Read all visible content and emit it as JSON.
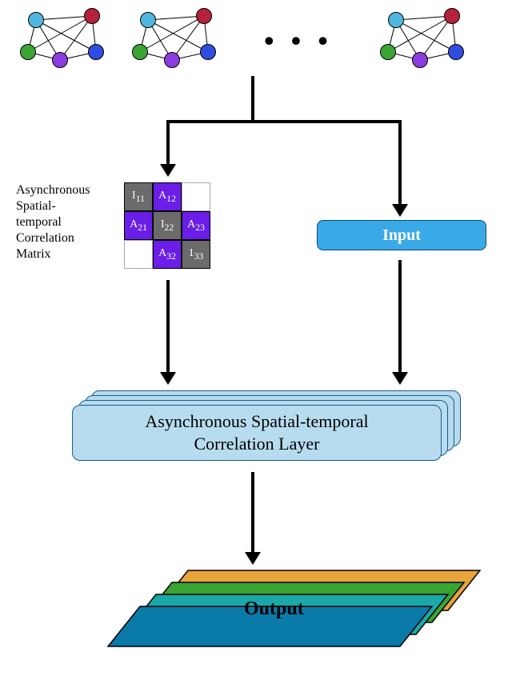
{
  "graphs": {
    "node_colors": [
      "#4fb6e0",
      "#b5223b",
      "#3aa532",
      "#8b3ce0",
      "#2f4de0"
    ]
  },
  "ellipsis": "• • •",
  "matrix": {
    "label_lines": [
      "Asynchronous",
      "Spatial-",
      "temporal",
      "Correlation",
      "Matrix"
    ],
    "cells": [
      {
        "kind": "gray",
        "text": "I",
        "sub": "11"
      },
      {
        "kind": "purple",
        "text": "A",
        "sub": "12"
      },
      {
        "kind": "white",
        "text": "",
        "sub": ""
      },
      {
        "kind": "purple",
        "text": "A",
        "sub": "21"
      },
      {
        "kind": "gray",
        "text": "I",
        "sub": "22"
      },
      {
        "kind": "purple",
        "text": "A",
        "sub": "23"
      },
      {
        "kind": "white",
        "text": "",
        "sub": ""
      },
      {
        "kind": "purple",
        "text": "A",
        "sub": "32"
      },
      {
        "kind": "gray",
        "text": "1",
        "sub": "33"
      }
    ]
  },
  "input_box": "Input",
  "layer_label": "Asynchronous Spatial-temporal\nCorrelation Layer",
  "output_label": "Output",
  "output_colors": [
    "#e8a33a",
    "#3aa532",
    "#1aa8a8",
    "#0a7aa8"
  ],
  "caption": ""
}
